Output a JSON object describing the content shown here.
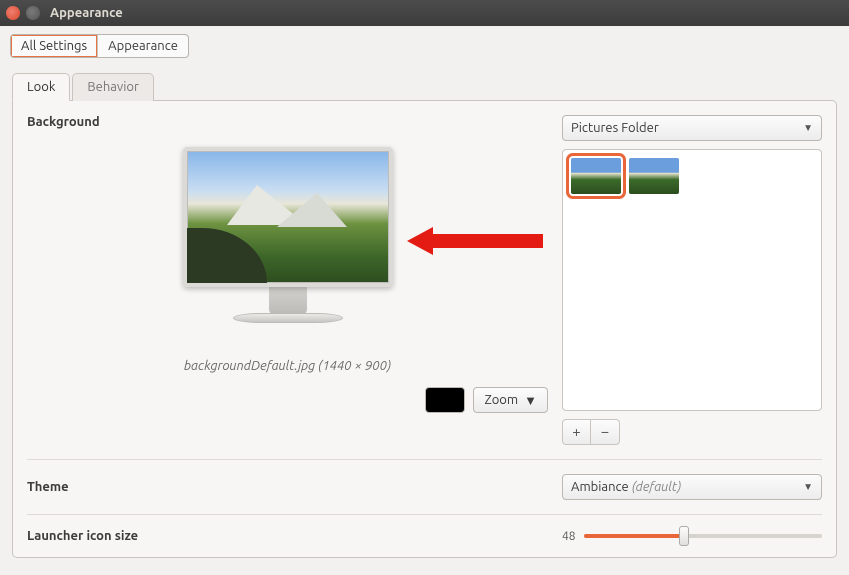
{
  "window": {
    "title": "Appearance"
  },
  "breadcrumb": {
    "all": "All Settings",
    "current": "Appearance"
  },
  "tabs": {
    "look": "Look",
    "behavior": "Behavior"
  },
  "background": {
    "label": "Background",
    "caption": "backgroundDefault.jpg (1440 × 900)",
    "source_selected": "Pictures Folder",
    "zoom_label": "Zoom",
    "add": "+",
    "remove": "−"
  },
  "theme": {
    "label": "Theme",
    "name": "Ambiance",
    "suffix": "(default)"
  },
  "launcher": {
    "label": "Launcher icon size",
    "value": "48"
  }
}
